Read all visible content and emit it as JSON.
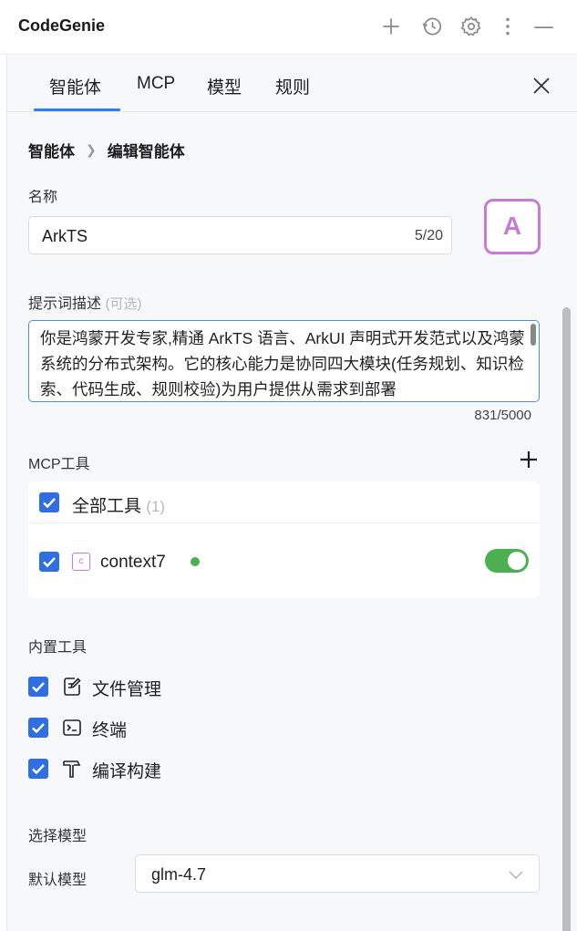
{
  "app": {
    "title": "CodeGenie",
    "icons": [
      "plus-icon",
      "history-icon",
      "gear-icon",
      "more-vertical-icon",
      "minimize-icon"
    ]
  },
  "tabs": [
    {
      "label": "智能体",
      "active": true
    },
    {
      "label": "MCP",
      "active": false
    },
    {
      "label": "模型",
      "active": false
    },
    {
      "label": "规则",
      "active": false
    }
  ],
  "breadcrumb": {
    "root": "智能体",
    "current": "编辑智能体"
  },
  "form": {
    "name_label": "名称",
    "name_value": "ArkTS",
    "name_count": "5/20",
    "avatar_letter": "A",
    "prompt_label": "提示词描述",
    "prompt_optional": "(可选)",
    "prompt_value": "你是鸿蒙开发专家,精通 ArkTS 语言、ArkUI 声明式开发范式以及鸿蒙系统的分布式架构。它的核心能力是协同四大模块(任务规划、知识检索、代码生成、规则校验)为用户提供从需求到部署",
    "prompt_count": "831/5000"
  },
  "mcp": {
    "label": "MCP工具",
    "all_tools_label": "全部工具",
    "all_tools_count": "(1)",
    "tools": [
      {
        "name": "context7",
        "icon_letter": "c",
        "enabled": true,
        "status": "online"
      }
    ]
  },
  "builtin": {
    "label": "内置工具",
    "tools": [
      {
        "label": "文件管理",
        "icon": "file-edit-icon",
        "checked": true
      },
      {
        "label": "终端",
        "icon": "terminal-icon",
        "checked": true
      },
      {
        "label": "编译构建",
        "icon": "hammer-icon",
        "checked": true
      }
    ]
  },
  "model": {
    "section_label": "选择模型",
    "default_label": "默认模型",
    "selected": "glm-4.7"
  },
  "colors": {
    "accent": "#2f7df6",
    "checkbox": "#2f6fe3",
    "avatar": "#c77bd6",
    "toggle_on": "#4caf50"
  }
}
